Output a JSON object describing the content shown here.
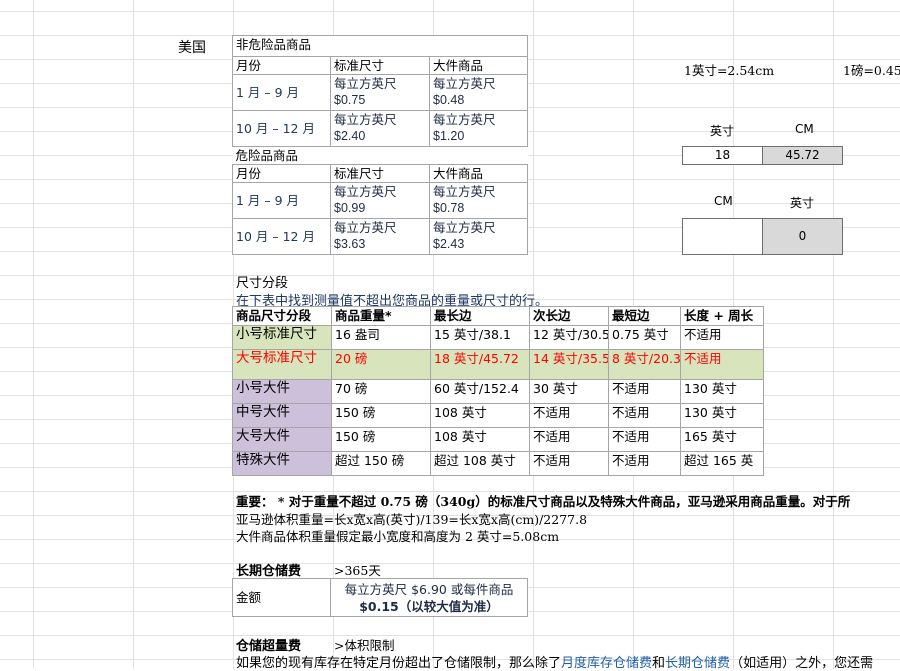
{
  "country": "美国",
  "non_dangerous": {
    "title": "非危险品商品",
    "headers": [
      "月份",
      "标准尺寸",
      "大件商品"
    ],
    "rows": [
      {
        "month": "1 月 – 9 月",
        "std_unit": "每立方英尺",
        "std_price": "$0.75",
        "large_unit": "每立方英尺",
        "large_price": "$0.48"
      },
      {
        "month": "10 月 – 12 月",
        "std_unit": "每立方英尺",
        "std_price": "$2.40",
        "large_unit": "每立方英尺",
        "large_price": "$1.20"
      }
    ]
  },
  "dangerous": {
    "title": "危险品商品",
    "headers": [
      "月份",
      "标准尺寸",
      "大件商品"
    ],
    "rows": [
      {
        "month": "1 月 – 9 月",
        "std_unit": "每立方英尺",
        "std_price": "$0.99",
        "large_unit": "每立方英尺",
        "large_price": "$0.78"
      },
      {
        "month": "10 月 – 12 月",
        "std_unit": "每立方英尺",
        "std_price": "$3.63",
        "large_unit": "每立方英尺",
        "large_price": "$2.43"
      }
    ]
  },
  "converter": {
    "inch_cm_note": "1英寸=2.54cm",
    "lb_note": "1磅=0.45",
    "inch_label": "英寸",
    "cm_label": "CM",
    "inch_value": "18",
    "cm_result": "45.72",
    "cm_label2": "CM",
    "inch_label2": "英寸",
    "cm_value2": "",
    "inch_result2": "0"
  },
  "size_tier": {
    "title": "尺寸分段",
    "subtitle": "在下表中找到测量值不超出您商品的重量或尺寸的行。",
    "headers": [
      "商品尺寸分段",
      "商品重量*",
      "最长边",
      "次长边",
      "最短边",
      "长度 + 周长"
    ],
    "rows": [
      {
        "tier": "小号标准尺寸",
        "weight": "16 盎司",
        "longest": "15 英寸/38.1",
        "median": "12 英寸/30.5",
        "shortest": "0.75 英寸",
        "girth": "不适用"
      },
      {
        "tier": "大号标准尺寸",
        "weight": "20 磅",
        "longest": "18 英寸/45.72",
        "median": "14 英寸/35.5",
        "shortest": "8 英寸/20.3",
        "girth": "不适用"
      },
      {
        "tier": "小号大件",
        "weight": "70 磅",
        "longest": "60 英寸/152.4",
        "median": "30 英寸",
        "shortest": "不适用",
        "girth": "130 英寸"
      },
      {
        "tier": "中号大件",
        "weight": "150 磅",
        "longest": "108 英寸",
        "median": "不适用",
        "shortest": "不适用",
        "girth": "130 英寸"
      },
      {
        "tier": "大号大件",
        "weight": "150 磅",
        "longest": "108 英寸",
        "median": "不适用",
        "shortest": "不适用",
        "girth": "165 英寸"
      },
      {
        "tier": "特殊大件",
        "weight": "超过 150 磅",
        "longest": "超过 108 英寸",
        "median": "不适用",
        "shortest": "不适用",
        "girth": "超过 165 英"
      }
    ]
  },
  "notes": {
    "important": "重要：  * 对于重量不超过 0.75 磅（340g）的标准尺寸商品以及特殊大件商品，亚马逊采用商品重量。对于所",
    "volume_formula": "亚马逊体积重量=长x宽x高(英寸)/139=长x宽x高(cm)/2277.8",
    "min_dims": "大件商品体积重量假定最小宽度和高度为 2 英寸=5.08cm"
  },
  "long_term": {
    "title": "长期仓储费",
    "period": ">365天",
    "amount_label": "金额",
    "amount_line1": "每立方英尺 $6.90 或每件商品",
    "amount_line2": "$0.15（以较大值为准）"
  },
  "overage": {
    "title": "仓储超量费",
    "limit": ">体积限制",
    "text_a": "如果您的现有库存在特定月份超出了仓储限制，那么除了",
    "link1": "月度库存仓储费",
    "text_b": "和",
    "link2": "长期仓储费",
    "text_c": "（如适用）之外，您还需"
  }
}
